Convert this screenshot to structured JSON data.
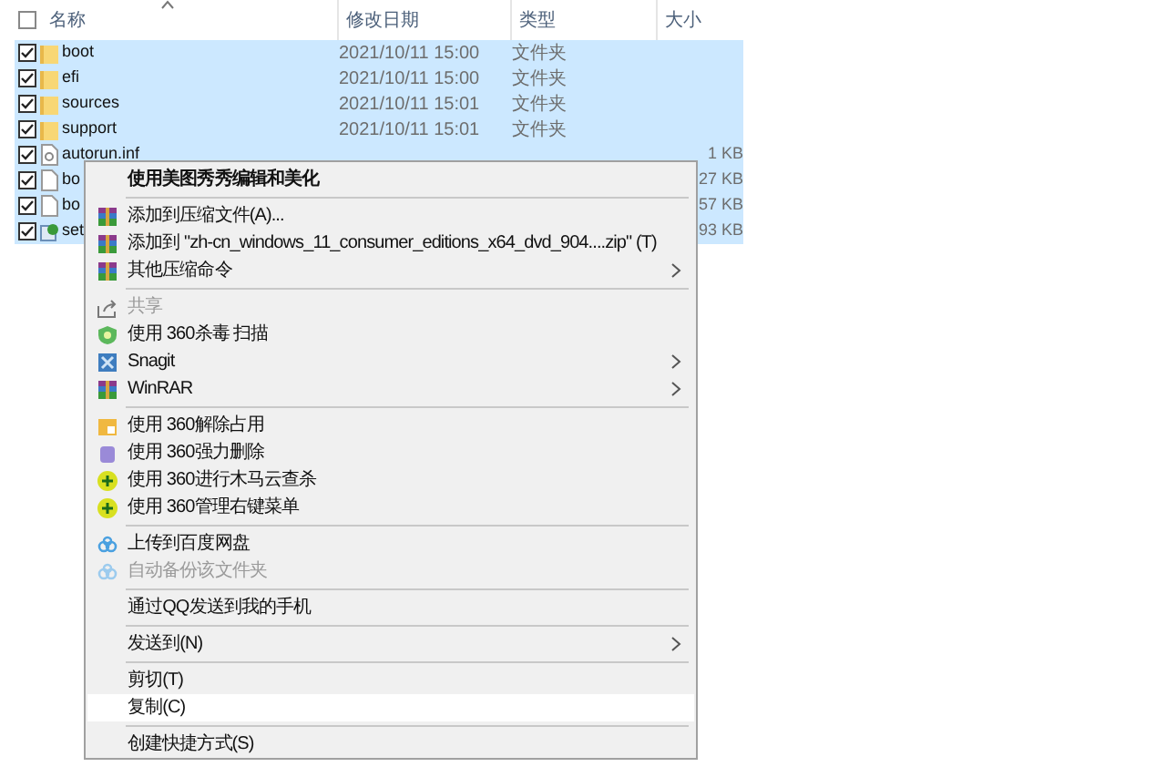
{
  "columns": [
    "名称",
    "修改日期",
    "类型",
    "大小"
  ],
  "header_checked": false,
  "files": [
    {
      "name": "boot",
      "date": "2021/10/11 15:00",
      "type": "文件夹",
      "kind": "folder",
      "checked": true
    },
    {
      "name": "efi",
      "date": "2021/10/11 15:00",
      "type": "文件夹",
      "kind": "folder",
      "checked": true
    },
    {
      "name": "sources",
      "date": "2021/10/11 15:01",
      "type": "文件夹",
      "kind": "folder",
      "checked": true
    },
    {
      "name": "support",
      "date": "2021/10/11 15:01",
      "type": "文件夹",
      "kind": "folder",
      "checked": true
    },
    {
      "name": "autorun.inf",
      "size": "1 KB",
      "kind": "config",
      "checked": true
    },
    {
      "name": "bo",
      "size": "27 KB",
      "kind": "file",
      "checked": true
    },
    {
      "name": "bo",
      "size": "57 KB",
      "kind": "file",
      "checked": true
    },
    {
      "name": "set",
      "size": "93 KB",
      "kind": "setup",
      "checked": true
    }
  ],
  "context_menu": [
    {
      "kind": "item",
      "label": "使用美图秀秀编辑和美化",
      "bold": true,
      "disabled": false,
      "submenu": false,
      "selected": false
    },
    {
      "kind": "separator"
    },
    {
      "kind": "item",
      "label": "添加到压缩文件(A)...",
      "disabled": false,
      "submenu": false,
      "selected": false
    },
    {
      "kind": "item",
      "label": "添加到 \"zh-cn_windows_11_consumer_editions_x64_dvd_904....zip\" (T)",
      "disabled": false,
      "submenu": false,
      "selected": false
    },
    {
      "kind": "item",
      "label": "其他压缩命令",
      "disabled": false,
      "submenu": true,
      "selected": false
    },
    {
      "kind": "separator"
    },
    {
      "kind": "item",
      "label": "共享",
      "disabled": true,
      "submenu": false,
      "selected": false
    },
    {
      "kind": "item",
      "label": "使用 360杀毒 扫描",
      "disabled": false,
      "submenu": false,
      "selected": false
    },
    {
      "kind": "item",
      "label": "Snagit",
      "disabled": false,
      "submenu": true,
      "selected": false
    },
    {
      "kind": "item",
      "label": "WinRAR",
      "disabled": false,
      "submenu": true,
      "selected": false
    },
    {
      "kind": "separator"
    },
    {
      "kind": "item",
      "label": "使用 360解除占用",
      "disabled": false,
      "submenu": false,
      "selected": false
    },
    {
      "kind": "item",
      "label": "使用 360强力删除",
      "disabled": false,
      "submenu": false,
      "selected": false
    },
    {
      "kind": "item",
      "label": "使用 360进行木马云查杀",
      "disabled": false,
      "submenu": false,
      "selected": false
    },
    {
      "kind": "item",
      "label": "使用 360管理右键菜单",
      "disabled": false,
      "submenu": false,
      "selected": false
    },
    {
      "kind": "separator"
    },
    {
      "kind": "item",
      "label": "上传到百度网盘",
      "disabled": false,
      "submenu": false,
      "selected": false
    },
    {
      "kind": "item",
      "label": "自动备份该文件夹",
      "disabled": true,
      "submenu": false,
      "selected": false
    },
    {
      "kind": "separator"
    },
    {
      "kind": "item",
      "label": "通过QQ发送到我的手机",
      "disabled": false,
      "submenu": false,
      "selected": false
    },
    {
      "kind": "separator"
    },
    {
      "kind": "item",
      "label": "发送到(N)",
      "disabled": false,
      "submenu": true,
      "selected": false
    },
    {
      "kind": "separator"
    },
    {
      "kind": "item",
      "label": "剪切(T)",
      "disabled": false,
      "submenu": false,
      "selected": false
    },
    {
      "kind": "item",
      "label": "复制(C)",
      "disabled": false,
      "submenu": false,
      "selected": true
    },
    {
      "kind": "separator"
    },
    {
      "kind": "item",
      "label": "创建快捷方式(S)",
      "disabled": false,
      "submenu": false,
      "selected": false
    }
  ]
}
